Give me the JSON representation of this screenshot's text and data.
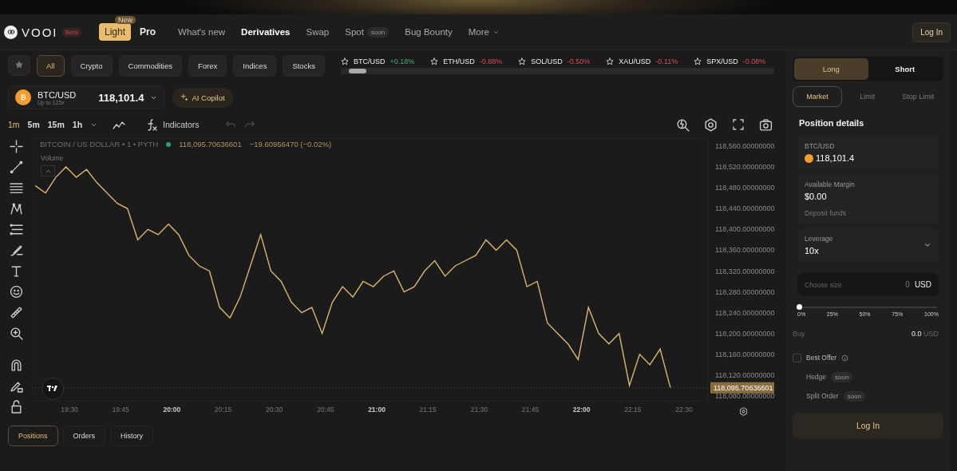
{
  "nav": {
    "brand": "VOOI",
    "brand_badge": "Beta",
    "modes": [
      {
        "label": "Light",
        "badge": "New",
        "selected": true
      },
      {
        "label": "Pro",
        "selected": false
      }
    ],
    "links": [
      {
        "label": "What's new",
        "selected": false
      },
      {
        "label": "Derivatives",
        "selected": true
      },
      {
        "label": "Swap",
        "selected": false
      },
      {
        "label": "Spot",
        "badge": "soon",
        "selected": false
      },
      {
        "label": "Bug Bounty",
        "selected": false
      },
      {
        "label": "More",
        "dropdown": true,
        "selected": false
      }
    ],
    "login": "Log In"
  },
  "filters": [
    {
      "label": "All",
      "selected": true
    },
    {
      "label": "Crypto",
      "selected": false
    },
    {
      "label": "Commodities",
      "selected": false
    },
    {
      "label": "Forex",
      "selected": false
    },
    {
      "label": "Indices",
      "selected": false
    },
    {
      "label": "Stocks",
      "selected": false
    }
  ],
  "ticker": [
    {
      "symbol": "BTC/USD",
      "change": "+0.18%",
      "kind": "up"
    },
    {
      "symbol": "ETH/USD",
      "change": "-0.88%",
      "kind": "down"
    },
    {
      "symbol": "SOL/USD",
      "change": "-0.50%",
      "kind": "down"
    },
    {
      "symbol": "XAU/USD",
      "change": "-0.11%",
      "kind": "down"
    },
    {
      "symbol": "SPX/USD",
      "change": "-0.08%",
      "kind": "down"
    }
  ],
  "market": {
    "symbol": "BTC/USD",
    "leverage_note": "Up to 125x",
    "price": "118,101.4",
    "copilot": "AI Copilot"
  },
  "chart_toolbar": {
    "intervals": [
      {
        "label": "1m",
        "selected": true
      },
      {
        "label": "5m",
        "selected": false
      },
      {
        "label": "15m",
        "selected": false
      },
      {
        "label": "1h",
        "selected": false
      }
    ],
    "indicators": "Indicators"
  },
  "legend": {
    "title": "BITCOIN / US DOLLAR • 1 • PYTH",
    "price": "118,095.70636601",
    "change": "−19.60956470 (−0.02%)",
    "volume": "Volume"
  },
  "chart": {
    "chart_data": {
      "type": "line",
      "xlim": [
        1159,
        1357
      ],
      "ylim": [
        118070,
        118575
      ],
      "ref_lines": [
        {
          "axis": "y",
          "value": 118095.70636601,
          "label": "118,095.70636601"
        }
      ],
      "x": [
        1160,
        1163,
        1166,
        1169,
        1172,
        1175,
        1178,
        1181,
        1184,
        1187,
        1190,
        1193,
        1196,
        1199,
        1202,
        1205,
        1208,
        1211,
        1214,
        1217,
        1220,
        1223,
        1226,
        1229,
        1232,
        1235,
        1238,
        1241,
        1244,
        1247,
        1250,
        1253,
        1256,
        1259,
        1262,
        1265,
        1268,
        1271,
        1274,
        1277,
        1280,
        1283,
        1286,
        1289,
        1292,
        1295,
        1298,
        1301,
        1304,
        1307,
        1310,
        1313,
        1316,
        1319,
        1322,
        1325,
        1328,
        1331,
        1334,
        1337,
        1340,
        1343,
        1346
      ],
      "series": [
        {
          "color": "#d9b66f",
          "values": [
            118484,
            118470,
            118500,
            118520,
            118500,
            118515,
            118490,
            118470,
            118450,
            118440,
            118380,
            118400,
            118390,
            118410,
            118390,
            118350,
            118330,
            118320,
            118250,
            118230,
            118270,
            118330,
            118390,
            118320,
            118300,
            118260,
            118240,
            118250,
            118200,
            118260,
            118290,
            118270,
            118300,
            118290,
            118310,
            118320,
            118280,
            118290,
            118320,
            118340,
            118310,
            118330,
            118340,
            118350,
            118380,
            118360,
            118380,
            118360,
            118290,
            118300,
            118220,
            118200,
            118180,
            118150,
            118250,
            118200,
            118180,
            118200,
            118100,
            118160,
            118140,
            118170,
            118096
          ]
        }
      ],
      "yticks": [
        {
          "value": 118080,
          "label": "118,080.00000000"
        },
        {
          "value": 118120,
          "label": "118,120.00000000"
        },
        {
          "value": 118160,
          "label": "118,160.00000000"
        },
        {
          "value": 118200,
          "label": "118,200.00000000"
        },
        {
          "value": 118240,
          "label": "118,240.00000000"
        },
        {
          "value": 118280,
          "label": "118,280.00000000"
        },
        {
          "value": 118320,
          "label": "118,320.00000000"
        },
        {
          "value": 118360,
          "label": "118,360.00000000"
        },
        {
          "value": 118400,
          "label": "118,400.00000000"
        },
        {
          "value": 118440,
          "label": "118,440.00000000"
        },
        {
          "value": 118480,
          "label": "118,480.00000000"
        },
        {
          "value": 118520,
          "label": "118,520.00000000"
        },
        {
          "value": 118560,
          "label": "118,560.00000000"
        }
      ],
      "xticks": [
        {
          "value": 1170,
          "label": "19:30"
        },
        {
          "value": 1185,
          "label": "19:45"
        },
        {
          "value": 1200,
          "label": "20:00"
        },
        {
          "value": 1215,
          "label": "20:15"
        },
        {
          "value": 1230,
          "label": "20:30"
        },
        {
          "value": 1245,
          "label": "20:45"
        },
        {
          "value": 1260,
          "label": "21:00"
        },
        {
          "value": 1275,
          "label": "21:15"
        },
        {
          "value": 1290,
          "label": "21:30"
        },
        {
          "value": 1305,
          "label": "21:45"
        },
        {
          "value": 1320,
          "label": "22:00"
        },
        {
          "value": 1335,
          "label": "22:15"
        },
        {
          "value": 1350,
          "label": "22:30"
        }
      ]
    }
  },
  "bottom_tabs": [
    {
      "label": "Positions",
      "selected": true
    },
    {
      "label": "Orders",
      "selected": false
    },
    {
      "label": "History",
      "selected": false
    }
  ],
  "trade": {
    "sides": [
      {
        "label": "Long",
        "selected": true
      },
      {
        "label": "Short",
        "selected": false
      }
    ],
    "order_types": [
      {
        "label": "Market",
        "selected": true
      },
      {
        "label": "Limit",
        "selected": false
      },
      {
        "label": "Stop Limit",
        "selected": false
      }
    ],
    "heading": "Position details",
    "pair_label": "BTC/USD",
    "pair_price": "118,101.4",
    "margin_label": "Available Margin",
    "margin_value": "$0.00",
    "deposit": "Deposit funds",
    "leverage_label": "Leverage",
    "leverage_value": "10x",
    "size_label": "Choose size",
    "size_placeholder": "0",
    "size_unit": "USD",
    "size_slider": {
      "level": 0,
      "marks": [
        "0%",
        "25%",
        "50%",
        "75%",
        "100%"
      ]
    },
    "buy_label": "Buy",
    "buy_value": "0.0",
    "buy_unit": "USD",
    "options": [
      {
        "label": "Best Offer",
        "kind": "checkbox",
        "checked": false,
        "info": true
      },
      {
        "label": "Hedge",
        "kind": "soon",
        "badge": "soon"
      },
      {
        "label": "Split Order",
        "kind": "soon",
        "badge": "soon"
      }
    ],
    "submit": "Log In"
  }
}
